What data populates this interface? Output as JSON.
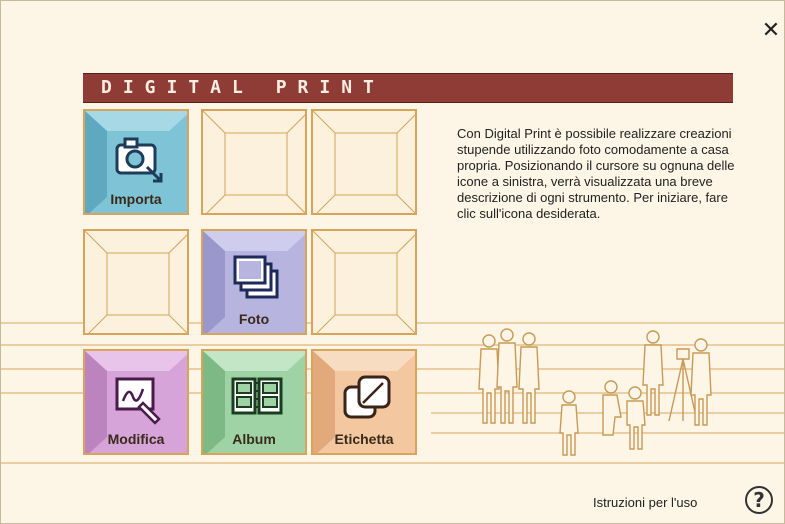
{
  "window": {
    "close_label": "✕",
    "banner_title": "DIGITAL PRINT"
  },
  "tools": {
    "importa": {
      "label": "Importa",
      "color": "#7ec3d6"
    },
    "foto": {
      "label": "Foto",
      "color": "#b7b4e0"
    },
    "modifica": {
      "label": "Modifica",
      "color": "#d7a4d9"
    },
    "album": {
      "label": "Album",
      "color": "#9fd3a6"
    },
    "etichetta": {
      "label": "Etichetta",
      "color": "#f3c7a0"
    }
  },
  "description": "Con Digital Print è possibile realizzare creazioni stupende utilizzando foto comodamente a casa propria. Posizionando il cursore su ognuna delle icone a sinistra, verrà visualizzata una breve descrizione di ogni strumento. Per iniziare, fare clic sull'icona desiderata.",
  "help": {
    "label": "Istruzioni per l'uso",
    "icon_glyph": "?"
  },
  "colors": {
    "banner": "#8f3b36",
    "background": "#fdf5e6",
    "line": "#d7a45a"
  }
}
